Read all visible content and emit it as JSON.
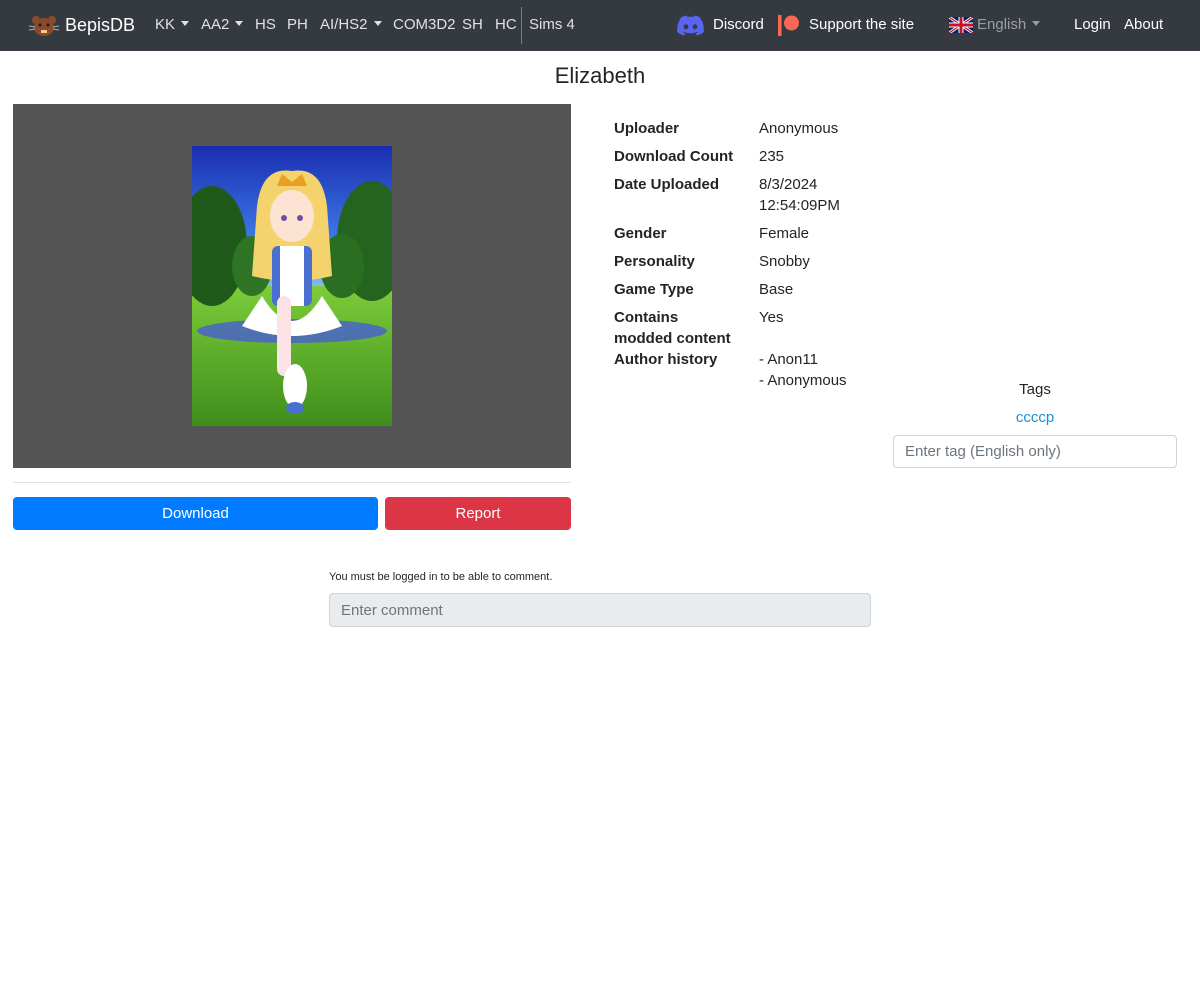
{
  "nav": {
    "brand": "BepisDB",
    "items": [
      {
        "label": "KK",
        "dropdown": true
      },
      {
        "label": "AA2",
        "dropdown": true
      },
      {
        "label": "HS",
        "dropdown": false
      },
      {
        "label": "PH",
        "dropdown": false
      },
      {
        "label": "AI/HS2",
        "dropdown": true
      },
      {
        "label": "COM3D2",
        "dropdown": false
      },
      {
        "label": "SH",
        "dropdown": false
      },
      {
        "label": "HC",
        "dropdown": false
      },
      {
        "label": "Sims 4",
        "dropdown": false
      }
    ],
    "discord_label": "Discord",
    "support_label": "Support the site",
    "language_label": "English",
    "login_label": "Login",
    "about_label": "About"
  },
  "card": {
    "title": "Elizabeth",
    "download_label": "Download",
    "report_label": "Report"
  },
  "info": {
    "uploader_label": "Uploader",
    "uploader_value": "Anonymous",
    "download_count_label": "Download Count",
    "download_count_value": "235",
    "date_uploaded_label": "Date Uploaded",
    "date_uploaded_date": "8/3/2024",
    "date_uploaded_time": "12:54:09PM",
    "gender_label": "Gender",
    "gender_value": "Female",
    "personality_label": "Personality",
    "personality_value": "Snobby",
    "game_type_label": "Game Type",
    "game_type_value": "Base",
    "modded_label_line1": "Contains",
    "modded_label_line2": "modded content",
    "modded_value": "Yes",
    "author_history_label": "Author history",
    "author_history": [
      "- Anon11",
      "- Anonymous"
    ]
  },
  "tags": {
    "title": "Tags",
    "items": [
      "ccccp"
    ],
    "input_placeholder": "Enter tag (English only)"
  },
  "comments": {
    "login_note": "You must be logged in to be able to comment.",
    "input_placeholder": "Enter comment"
  },
  "colors": {
    "navbar": "#343a40",
    "download_button": "#007bff",
    "report_button": "#dc3545",
    "tag_link": "#1a8fd6",
    "preview_background": "#555555"
  },
  "icons": [
    "bepisdb-logo-icon",
    "discord-icon",
    "patreon-icon",
    "uk-flag-icon",
    "caret-down-icon"
  ]
}
